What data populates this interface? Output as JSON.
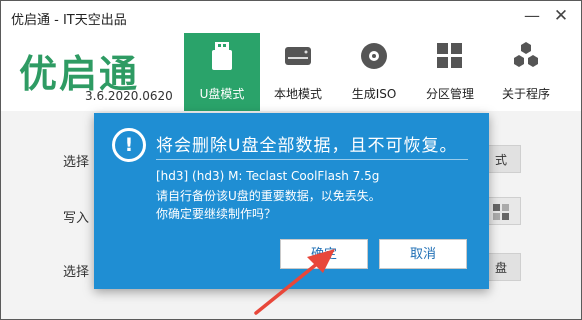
{
  "window": {
    "title": "优启通 - IT天空出品"
  },
  "title_buttons": {
    "minimize": "—",
    "close": "✕"
  },
  "header": {
    "logo_text": "优启通",
    "version": "3.6.2020.0620"
  },
  "nav": {
    "items": [
      {
        "label": "U盘模式",
        "icon": "usb-drive-icon",
        "active": true
      },
      {
        "label": "本地模式",
        "icon": "hard-disk-icon",
        "active": false
      },
      {
        "label": "生成ISO",
        "icon": "disc-icon",
        "active": false
      },
      {
        "label": "分区管理",
        "icon": "partition-grid-icon",
        "active": false
      },
      {
        "label": "关于程序",
        "icon": "hexagon-cluster-icon",
        "active": false
      }
    ]
  },
  "main": {
    "rows": [
      {
        "label": "选择",
        "button": "式"
      },
      {
        "label": "写入",
        "button": ""
      },
      {
        "label": "选择",
        "button": "盘"
      }
    ]
  },
  "dialog": {
    "title": "将会删除U盘全部数据，且不可恢复。",
    "device": "[hd3] (hd3) M: Teclast CoolFlash 7.5g",
    "line2": "请自行备份该U盘的重要数据，以免丢失。",
    "line3": "你确定要继续制作吗？",
    "ok_label": "确定",
    "cancel_label": "取消"
  },
  "colors": {
    "accent": "#2aa36a",
    "dialog_bg": "#1f8ed3",
    "arrow": "#e8473a"
  }
}
